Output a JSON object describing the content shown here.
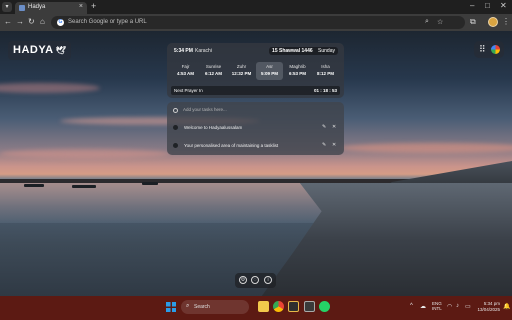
{
  "browser": {
    "tab_title": "Hadya",
    "address_placeholder": "Search Google or type a URL"
  },
  "page": {
    "logo_text": "HADYA",
    "prayer_card": {
      "current_time": "5:34 PM",
      "city": "Karachi",
      "hijri_date": "15 Shawwal 1446",
      "weekday": "Sunday",
      "prayers": [
        {
          "name": "Fajr",
          "time": "4:53 AM"
        },
        {
          "name": "Sunrise",
          "time": "6:12 AM"
        },
        {
          "name": "Zuhr",
          "time": "12:32 PM"
        },
        {
          "name": "Asr",
          "time": "5:09 PM",
          "active": true
        },
        {
          "name": "Maghrib",
          "time": "6:53 PM"
        },
        {
          "name": "Isha",
          "time": "8:12 PM"
        }
      ],
      "next_prayer_label": "Next Prayer In",
      "next_prayer_countdown": "01 : 18 : 53"
    },
    "todo": {
      "placeholder": "Add your tasks here...",
      "items": [
        {
          "text": "Welcome to Hadyaalussalam"
        },
        {
          "text": "Your personalised area of maintaining a tasklist"
        }
      ]
    }
  },
  "taskbar": {
    "search_placeholder": "Search",
    "language_line1": "ENG",
    "language_line2": "INTL",
    "time": "5:34 pm",
    "date": "13/04/2025"
  }
}
